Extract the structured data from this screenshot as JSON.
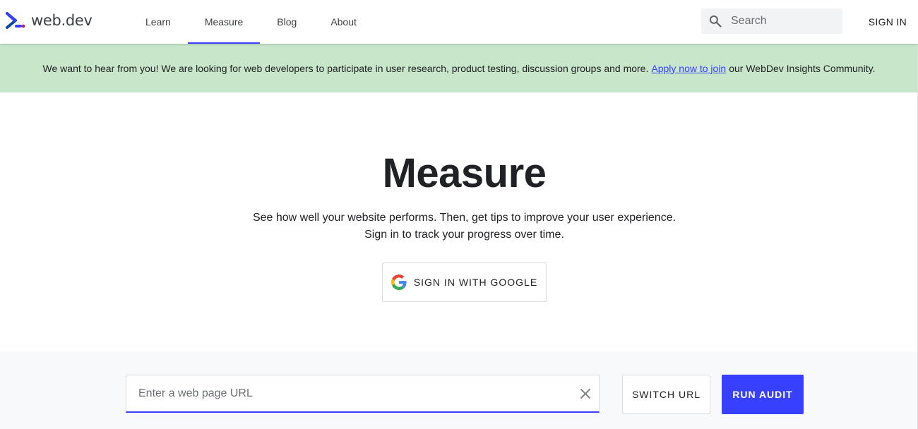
{
  "header": {
    "logo_text": "web.dev",
    "nav": [
      {
        "label": "Learn",
        "active": false
      },
      {
        "label": "Measure",
        "active": true
      },
      {
        "label": "Blog",
        "active": false
      },
      {
        "label": "About",
        "active": false
      }
    ],
    "search_placeholder": "Search",
    "signin_label": "SIGN IN"
  },
  "banner": {
    "text_before": "We want to hear from you! We are looking for web developers to participate in user research, product testing, discussion groups and more.",
    "link_text": "Apply now to join",
    "text_after": "our WebDev Insights Community."
  },
  "hero": {
    "title": "Measure",
    "subtitle_line1": "See how well your website performs. Then, get tips to improve your user experience.",
    "subtitle_line2": "Sign in to track your progress over time.",
    "google_button": "SIGN IN WITH GOOGLE"
  },
  "audit": {
    "url_placeholder": "Enter a web page URL",
    "url_value": "",
    "switch_url_label": "SWITCH URL",
    "run_audit_label": "RUN AUDIT"
  },
  "colors": {
    "accent": "#3740ff",
    "banner_bg": "#c8e6c9",
    "audit_bg": "#f8f9fa"
  },
  "icons": {
    "logo": "web-dev-chevron-icon",
    "search": "search-icon",
    "google": "google-g-icon",
    "clear": "close-icon"
  }
}
